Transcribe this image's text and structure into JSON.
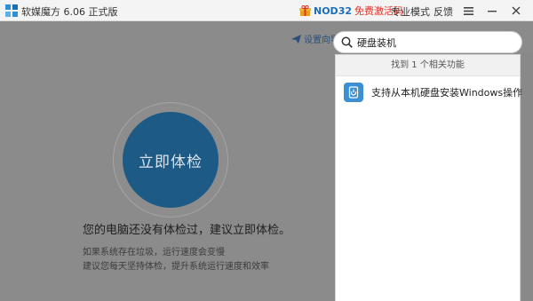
{
  "titlebar": {
    "app_title": "软媒魔方 6.06 正式版",
    "promo_nod": "NOD32",
    "promo_text": "免费激活码",
    "pro_mode": "专业模式",
    "feedback": "反馈"
  },
  "main": {
    "setup_guide": "设置向导",
    "check_button": "立即体检",
    "status_message": "您的电脑还没有体检过，建议立即体检。",
    "hint_line1": "如果系统存在垃圾，运行速度会变慢",
    "hint_line2": "建议您每天坚持体检，提升系统运行速度和效率"
  },
  "search": {
    "value": "硬盘装机",
    "results_header": "找到 1 个相关功能",
    "results": [
      {
        "label": "支持从本机硬盘安装Windows操作...",
        "icon": "hdd-install-icon"
      }
    ]
  },
  "colors": {
    "accent_blue": "#1e5a86",
    "promo_red": "#e0352b",
    "promo_blue": "#1b6fb8",
    "overlay_gray": "#8b8b8b"
  }
}
